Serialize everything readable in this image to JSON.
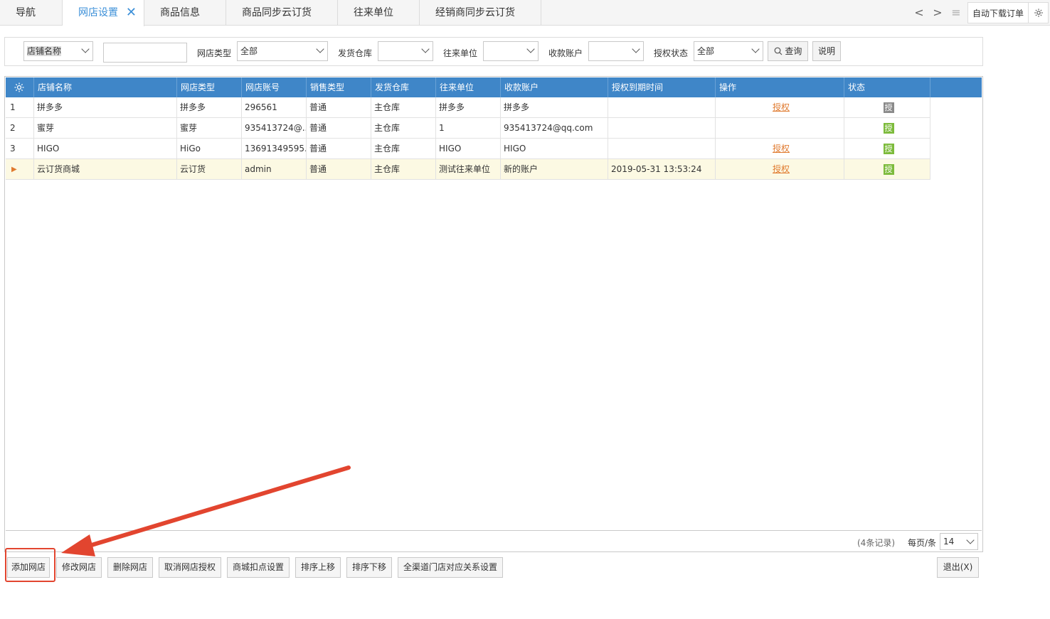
{
  "tabs": [
    {
      "label": "导航",
      "active": false
    },
    {
      "label": "网店设置",
      "active": true
    },
    {
      "label": "商品信息",
      "active": false
    },
    {
      "label": "商品同步云订货",
      "active": false
    },
    {
      "label": "往来单位",
      "active": false
    },
    {
      "label": "经销商同步云订货",
      "active": false
    }
  ],
  "tab_controls": {
    "prev": "<",
    "next": ">",
    "list": "≡",
    "auto_download": "自动下载订单"
  },
  "filters": {
    "field_select": "店铺名称",
    "search_value": "",
    "shop_type_label": "网店类型",
    "shop_type_value": "全部",
    "warehouse_label": "发货仓库",
    "warehouse_value": "",
    "partner_label": "往来单位",
    "partner_value": "",
    "account_label": "收款账户",
    "account_value": "",
    "auth_label": "授权状态",
    "auth_value": "全部",
    "query_button": "查询",
    "help_button": "说明"
  },
  "table": {
    "columns": [
      "店铺名称",
      "网店类型",
      "网店账号",
      "销售类型",
      "发货仓库",
      "往来单位",
      "收款账户",
      "授权到期时间",
      "操作",
      "状态"
    ],
    "rows": [
      {
        "no": "1",
        "name": "拼多多",
        "type": "拼多多",
        "account": "296561",
        "sale": "普通",
        "warehouse": "主仓库",
        "partner": "拼多多",
        "pay": "拼多多",
        "expire": "",
        "op": "授权",
        "status": "授",
        "status_color": "#8a8a8a"
      },
      {
        "no": "2",
        "name": "蜜芽",
        "type": "蜜芽",
        "account": "935413724@...",
        "sale": "普通",
        "warehouse": "主仓库",
        "partner": "1",
        "pay": "935413724@qq.com",
        "expire": "",
        "op": "",
        "status": "授",
        "status_color": "#7dbb3c"
      },
      {
        "no": "3",
        "name": "HIGO",
        "type": "HiGo",
        "account": "13691349595...",
        "sale": "普通",
        "warehouse": "主仓库",
        "partner": "HIGO",
        "pay": "HIGO",
        "expire": "",
        "op": "授权",
        "status": "授",
        "status_color": "#7dbb3c"
      },
      {
        "no": "▶",
        "name": "云订货商城",
        "type": "云订货",
        "account": "admin",
        "sale": "普通",
        "warehouse": "主仓库",
        "partner": "测试往来单位",
        "pay": "新的账户",
        "expire": "2019-05-31 13:53:24",
        "op": "授权",
        "status": "授",
        "status_color": "#7dbb3c"
      }
    ],
    "record_count": "(4条记录)",
    "per_page_label": "每页/条",
    "per_page_value": "14"
  },
  "actions": [
    "添加网店",
    "修改网店",
    "删除网店",
    "取消网店授权",
    "商城扣点设置",
    "排序上移",
    "排序下移",
    "全渠道门店对应关系设置"
  ],
  "exit_button": "退出(X)"
}
